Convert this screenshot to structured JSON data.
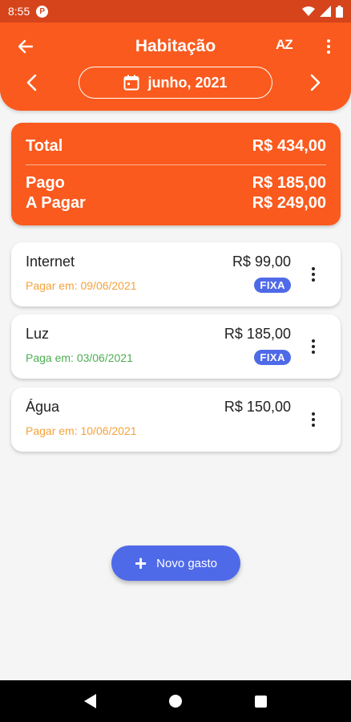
{
  "status_bar": {
    "time": "8:55"
  },
  "header": {
    "title": "Habitação",
    "sort_label": "AZ",
    "month": "junho, 2021"
  },
  "summary": {
    "total_label": "Total",
    "total_value": "R$ 434,00",
    "paid_label": "Pago",
    "paid_value": "R$ 185,00",
    "to_pay_label": "A Pagar",
    "to_pay_value": "R$ 249,00"
  },
  "expenses": [
    {
      "name": "Internet",
      "value": "R$ 99,00",
      "due": "Pagar em: 09/06/2021",
      "status": "pending",
      "badge": "FIXA"
    },
    {
      "name": "Luz",
      "value": "R$ 185,00",
      "due": "Paga em: 03/06/2021",
      "status": "paid",
      "badge": "FIXA"
    },
    {
      "name": "Água",
      "value": "R$ 150,00",
      "due": "Pagar em: 10/06/2021",
      "status": "pending",
      "badge": ""
    }
  ],
  "fab": {
    "label": "Novo gasto"
  },
  "colors": {
    "primary": "#fa5a1e",
    "accent": "#4f6ae8",
    "pending": "#f5a23a",
    "paid": "#4cae52"
  },
  "icons": [
    "back-arrow-icon",
    "sort-az-icon",
    "more-vert-icon",
    "chevron-left-icon",
    "calendar-icon",
    "chevron-right-icon",
    "plus-icon"
  ]
}
